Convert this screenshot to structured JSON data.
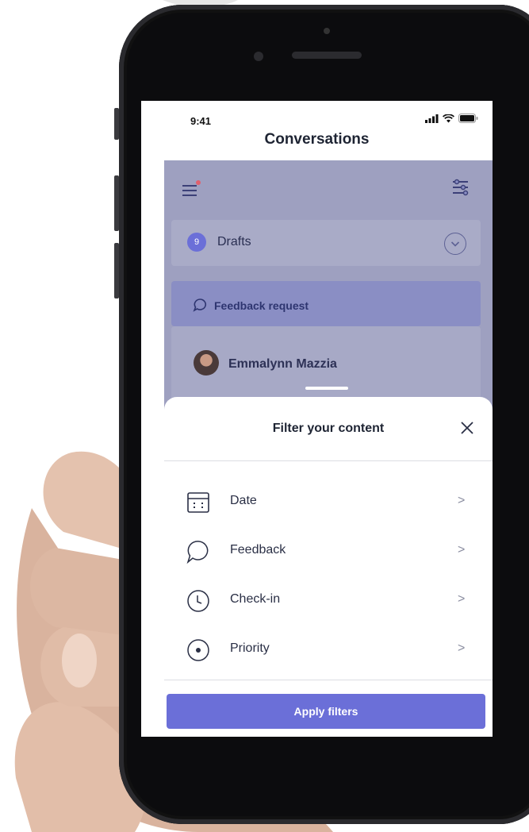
{
  "status_bar": {
    "time": "9:41"
  },
  "nav": {
    "title": "Conversations"
  },
  "background": {
    "drafts": {
      "count": "9",
      "label": "Drafts"
    },
    "feedback_request": "Feedback request",
    "person": "Emmalynn Mazzia"
  },
  "sheet": {
    "title": "Filter your content",
    "rows": [
      {
        "label": "Date",
        "icon": "calendar-icon"
      },
      {
        "label": "Feedback",
        "icon": "chat-bubble-icon"
      },
      {
        "label": "Check-in",
        "icon": "clock-icon"
      },
      {
        "label": "Priority",
        "icon": "radio-dot-icon"
      }
    ],
    "chevron": ">",
    "apply_label": "Apply filters"
  },
  "colors": {
    "accent": "#6b6fd8",
    "overlay": "#4e528c",
    "text": "#1e2433"
  }
}
